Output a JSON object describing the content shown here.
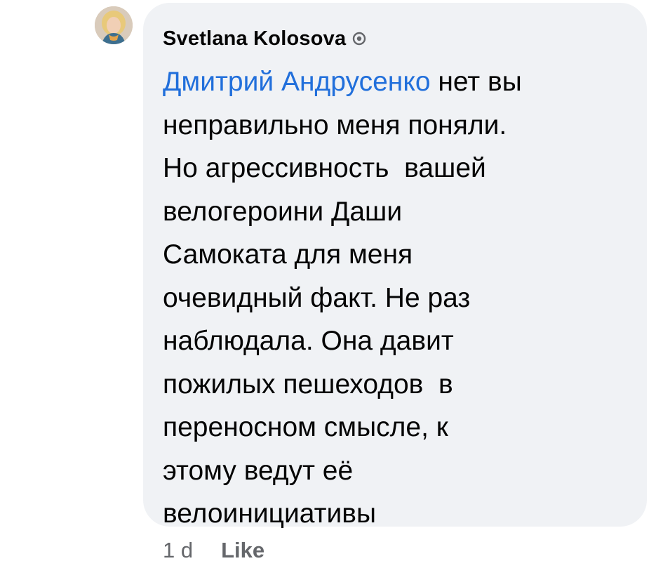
{
  "comment": {
    "author": "Svetlana Kolosova",
    "badge_icon": "profile-badge-icon",
    "mention": "Дмитрий Андрусенко",
    "lines": [
      " нет вы",
      "неправильно меня поняли.",
      "Но агрессивность  вашей",
      "велогероини Даши",
      "Самоката для меня",
      "очевидный факт. Не раз",
      "наблюдала. Она давит",
      "пожилых пешеходов  в",
      "переносном смысле, к",
      "этому ведут её",
      "велоинициативы"
    ],
    "time": "1 d",
    "like_label": "Like"
  },
  "colors": {
    "bubble": "#f0f2f5",
    "mention": "#216fdb",
    "text": "#050505",
    "meta": "#65676b"
  }
}
